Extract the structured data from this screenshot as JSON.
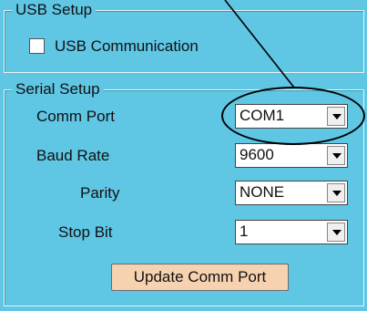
{
  "usb_setup": {
    "title": "USB Setup",
    "usb_communication_label": "USB Communication",
    "usb_communication_checked": false
  },
  "serial_setup": {
    "title": "Serial Setup",
    "comm_port": {
      "label": "Comm Port",
      "value": "COM1"
    },
    "baud_rate": {
      "label": "Baud Rate",
      "value": "9600"
    },
    "parity": {
      "label": "Parity",
      "value": "NONE"
    },
    "stop_bit": {
      "label": "Stop Bit",
      "value": "1"
    },
    "update_button_label": "Update Comm Port"
  },
  "colors": {
    "panel_background": "#5fc6e4",
    "button_background": "#f7d2b1"
  }
}
